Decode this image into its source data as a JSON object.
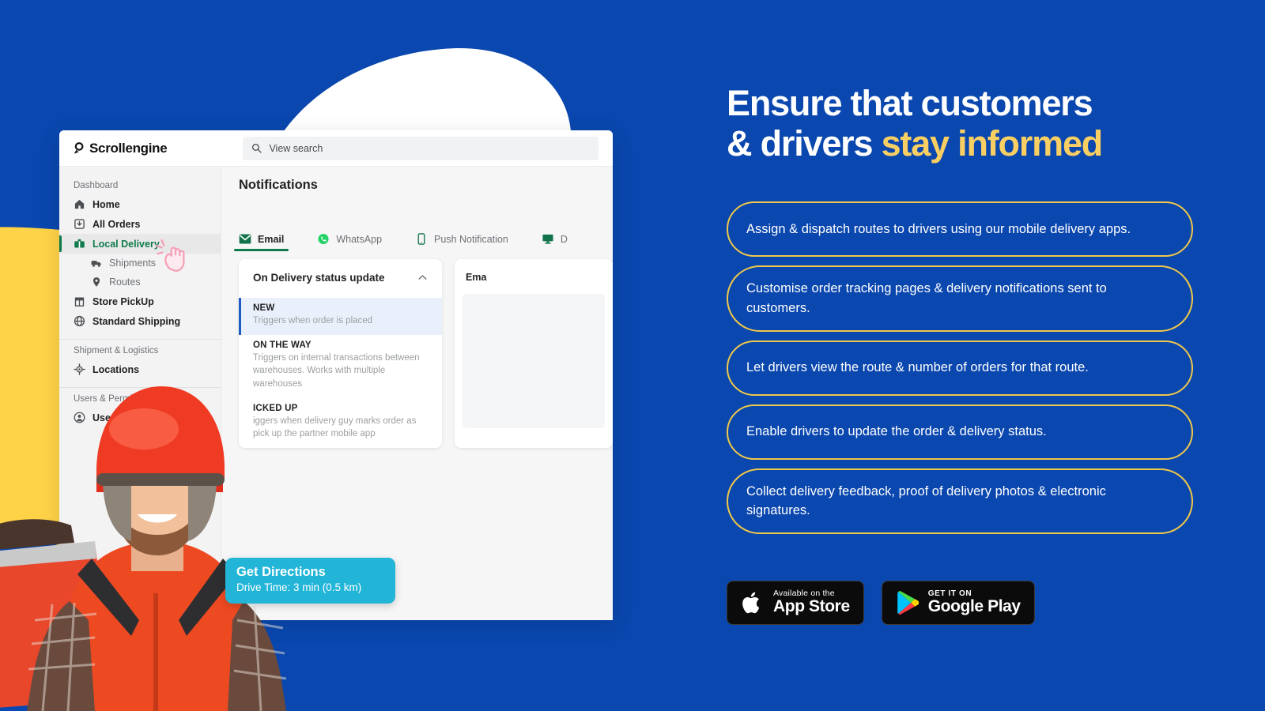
{
  "theme": {
    "background_blue": "#0a47ae",
    "accent_yellow": "#f9cf63",
    "pill_border": "#efc84a",
    "blob_yellow": "#ffd348",
    "blob_white": "#ffffff",
    "brand_green": "#0f7a4a",
    "badge_cyan": "#22b5d8"
  },
  "app": {
    "brand_name": "Scrollengine",
    "search": {
      "placeholder": "View search"
    },
    "sidebar": {
      "sections": [
        {
          "title": "Dashboard",
          "items": [
            {
              "label": "Home",
              "icon": "home-icon",
              "active": false
            },
            {
              "label": "All Orders",
              "icon": "orders-icon",
              "active": false
            },
            {
              "label": "Local Delivery",
              "icon": "local-delivery-icon",
              "active": true
            },
            {
              "label": "Shipments",
              "icon": "truck-icon",
              "sub": true
            },
            {
              "label": "Routes",
              "icon": "pin-icon",
              "sub": true
            },
            {
              "label": "Store PickUp",
              "icon": "store-icon",
              "active": false
            },
            {
              "label": "Standard Shipping",
              "icon": "globe-icon",
              "active": false
            }
          ]
        },
        {
          "title": "Shipment & Logistics",
          "items": [
            {
              "label": "Locations",
              "icon": "target-icon",
              "active": false
            }
          ]
        },
        {
          "title": "Users & Permissions",
          "items": [
            {
              "label": "Users",
              "icon": "user-icon",
              "active": false
            }
          ]
        }
      ]
    },
    "content": {
      "title": "Notifications",
      "tabs": [
        {
          "label": "Email",
          "icon": "envelope-icon",
          "active": true
        },
        {
          "label": "WhatsApp",
          "icon": "whatsapp-icon",
          "active": false
        },
        {
          "label": "Push Notification",
          "icon": "mobile-icon",
          "active": false
        },
        {
          "label": "D",
          "icon": "desktop-icon",
          "active": false
        }
      ],
      "card": {
        "title": "On Delivery status update",
        "collapse_icon": "chevron-up-icon",
        "statuses": [
          {
            "name": "NEW",
            "desc": "Triggers when order is placed",
            "selected": true
          },
          {
            "name": "ON THE WAY",
            "desc": "Triggers on internal transactions between warehouses. Works with multiple warehouses",
            "selected": false
          },
          {
            "name": "ICKED UP",
            "desc": "iggers when delivery guy marks order as pick up the partner mobile app",
            "selected": false
          }
        ]
      },
      "side_card": {
        "title": "Ema"
      }
    }
  },
  "directions_badge": {
    "title": "Get Directions",
    "subtitle": "Drive Time: 3 min (0.5 km)"
  },
  "marketing": {
    "headline_line1": "Ensure that customers",
    "headline_line2_plain": "& drivers ",
    "headline_line2_accent": "stay informed",
    "pills": [
      "Assign & dispatch routes to drivers using our mobile delivery apps.",
      "Customise order tracking pages & delivery notifications sent to customers.",
      "Let drivers view the route & number of orders for that route.",
      "Enable drivers to update the order & delivery status.",
      "Collect delivery feedback, proof of delivery photos & electronic signatures."
    ],
    "stores": [
      {
        "icon": "apple-icon",
        "small": "Available on the",
        "big": "App Store"
      },
      {
        "icon": "google-play-icon",
        "small": "GET IT ON",
        "big": "Google Play"
      }
    ]
  }
}
